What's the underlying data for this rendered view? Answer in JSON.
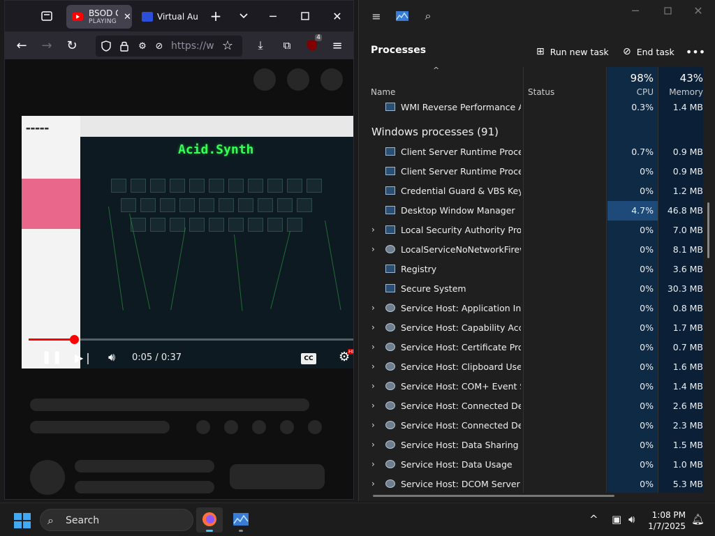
{
  "firefox": {
    "tabs": [
      {
        "title": "BSOD G",
        "subtitle": "PLAYING"
      },
      {
        "title": "Virtual Au"
      }
    ],
    "url": "https://w",
    "extension_badge": "4",
    "video": {
      "overlay_title": "Acid.Synth",
      "time": "0:05 / 0:37",
      "progress": 0.14,
      "cc_label": "CC",
      "hd_badge": "HD"
    }
  },
  "taskmanager": {
    "section_title": "Processes",
    "run_new_task": "Run new task",
    "end_task": "End task",
    "columns": {
      "name": "Name",
      "status": "Status",
      "cpu_total": "98%",
      "cpu_label": "CPU",
      "mem_total": "43%",
      "mem_label": "Memory"
    },
    "top_row": {
      "name": "WMI Reverse Performance Ad...",
      "cpu": "0.3%",
      "mem": "1.4 MB"
    },
    "group_title": "Windows processes (91)",
    "rows": [
      {
        "expand": false,
        "icon": "window",
        "name": "Client Server Runtime Process",
        "cpu": "0.7%",
        "mem": "0.9 MB"
      },
      {
        "expand": false,
        "icon": "window",
        "name": "Client Server Runtime Process",
        "cpu": "0%",
        "mem": "0.9 MB"
      },
      {
        "expand": false,
        "icon": "window",
        "name": "Credential Guard & VBS Key Is...",
        "cpu": "0%",
        "mem": "1.2 MB"
      },
      {
        "expand": false,
        "icon": "window",
        "name": "Desktop Window Manager",
        "cpu": "4.7%",
        "mem": "46.8 MB",
        "highlight": true
      },
      {
        "expand": true,
        "icon": "window",
        "name": "Local Security Authority Proce...",
        "cpu": "0%",
        "mem": "7.0 MB"
      },
      {
        "expand": true,
        "icon": "gear",
        "name": "LocalServiceNoNetworkFirewa...",
        "cpu": "0%",
        "mem": "8.1 MB"
      },
      {
        "expand": false,
        "icon": "window",
        "name": "Registry",
        "cpu": "0%",
        "mem": "3.6 MB"
      },
      {
        "expand": false,
        "icon": "window",
        "name": "Secure System",
        "cpu": "0%",
        "mem": "30.3 MB"
      },
      {
        "expand": true,
        "icon": "gear",
        "name": "Service Host: Application Infor...",
        "cpu": "0%",
        "mem": "0.8 MB"
      },
      {
        "expand": true,
        "icon": "gear",
        "name": "Service Host: Capability Acces...",
        "cpu": "0%",
        "mem": "1.7 MB"
      },
      {
        "expand": true,
        "icon": "gear",
        "name": "Service Host: Certificate Propa...",
        "cpu": "0%",
        "mem": "0.7 MB"
      },
      {
        "expand": true,
        "icon": "gear",
        "name": "Service Host: Clipboard User S...",
        "cpu": "0%",
        "mem": "1.6 MB"
      },
      {
        "expand": true,
        "icon": "gear",
        "name": "Service Host: COM+ Event Sys...",
        "cpu": "0%",
        "mem": "1.4 MB"
      },
      {
        "expand": true,
        "icon": "gear",
        "name": "Service Host: Connected Devi...",
        "cpu": "0%",
        "mem": "2.6 MB"
      },
      {
        "expand": true,
        "icon": "gear",
        "name": "Service Host: Connected Devi...",
        "cpu": "0%",
        "mem": "2.3 MB"
      },
      {
        "expand": true,
        "icon": "gear",
        "name": "Service Host: Data Sharing Ser...",
        "cpu": "0%",
        "mem": "1.5 MB"
      },
      {
        "expand": true,
        "icon": "gear",
        "name": "Service Host: Data Usage",
        "cpu": "0%",
        "mem": "1.0 MB"
      },
      {
        "expand": true,
        "icon": "gear",
        "name": "Service Host: DCOM Server Pr...",
        "cpu": "0%",
        "mem": "5.3 MB"
      }
    ]
  },
  "taskbar": {
    "search_label": "Search",
    "time": "1:08 PM",
    "date": "1/7/2025"
  },
  "colors": {
    "accent": "#4cc2ff",
    "cpu_col": "#0f2a44",
    "cpu_highlight": "#1d4a78",
    "youtube_red": "#ff0000",
    "acid_green": "#33ff55"
  }
}
